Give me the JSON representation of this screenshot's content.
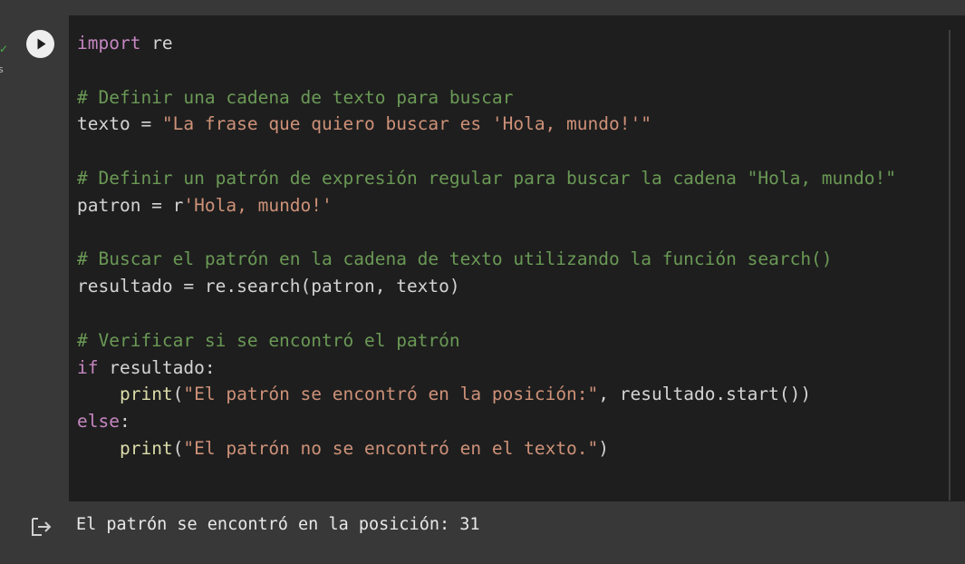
{
  "status": {
    "check": "✓",
    "time": "s"
  },
  "run_button": {
    "icon": "play-icon"
  },
  "code": {
    "l1": {
      "kw": "import",
      "rest": " re"
    },
    "l3": {
      "comment": "# Definir una cadena de texto para buscar"
    },
    "l4": {
      "lhs": "texto = ",
      "str": "\"La frase que quiero buscar es 'Hola, mundo!'\""
    },
    "l6": {
      "comment": "# Definir un patrón de expresión regular para buscar la cadena \"Hola, mundo!\""
    },
    "l7": {
      "lhs": "patron = r",
      "str": "'Hola, mundo!'"
    },
    "l9": {
      "comment": "# Buscar el patrón en la cadena de texto utilizando la función search()"
    },
    "l10": {
      "text": "resultado = re.search(patron, texto)"
    },
    "l12": {
      "comment": "# Verificar si se encontró el patrón"
    },
    "l13": {
      "kw": "if",
      "rest": " resultado:"
    },
    "l14": {
      "indent": "    ",
      "fn": "print",
      "open": "(",
      "str": "\"El patrón se encontró en la posición:\"",
      "rest": ", resultado.start())"
    },
    "l15": {
      "kw": "else",
      "rest": ":"
    },
    "l16": {
      "indent": "    ",
      "fn": "print",
      "open": "(",
      "str": "\"El patrón no se encontró en el texto.\"",
      "rest": ")"
    }
  },
  "output": {
    "icon": "output-redirect-icon",
    "text": "El patrón se encontró en la posición: 31"
  },
  "colors": {
    "keyword": "#c586c0",
    "comment": "#6a9955",
    "string": "#ce9178",
    "function": "#dcdcaa",
    "text": "#d4d4d4",
    "editor_bg": "#1e1e1e",
    "chrome_bg": "#383838"
  }
}
